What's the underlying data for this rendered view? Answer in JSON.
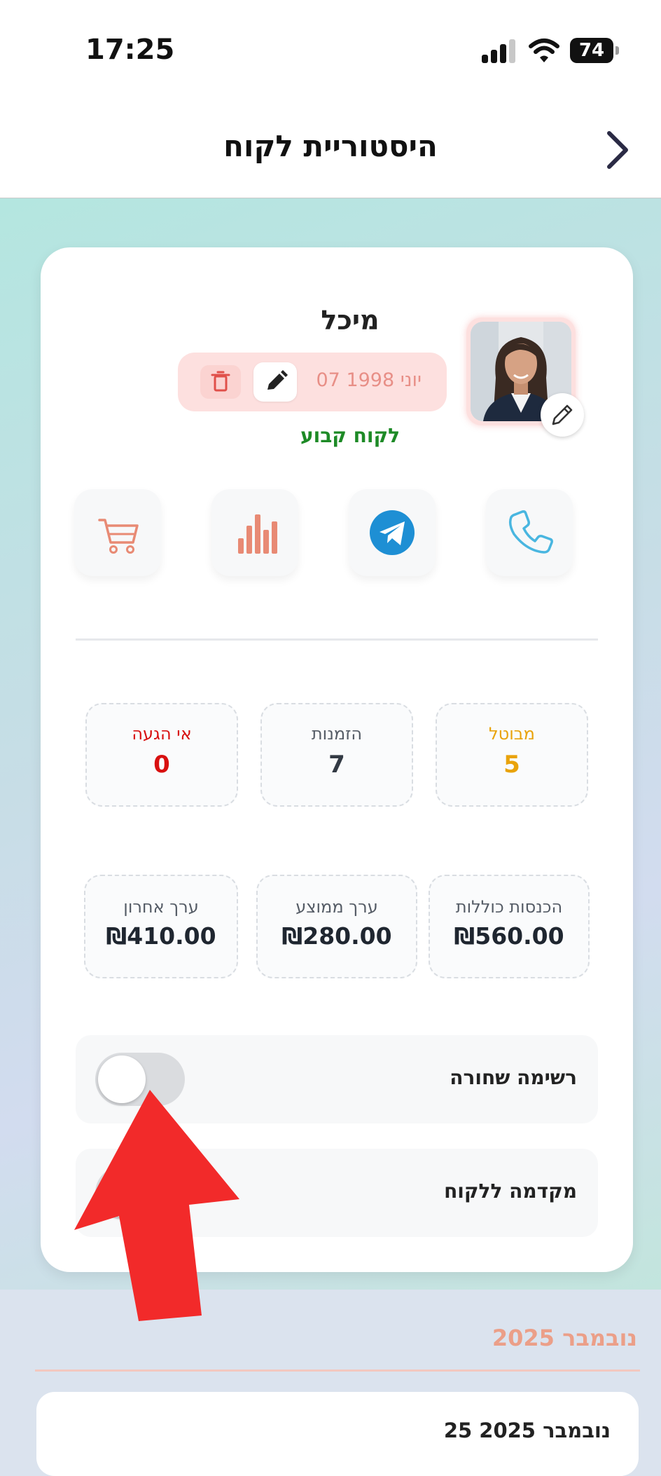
{
  "status_bar": {
    "time": "17:25",
    "battery_level": "74",
    "signal_bars": 3
  },
  "header": {
    "title": "היסטוריית לקוח"
  },
  "customer": {
    "name": "מיכל",
    "birthdate": "07 יוני 1998",
    "type": "לקוח קבוע",
    "avatar_icon": "customer-photo"
  },
  "actions": {
    "phone_icon": "phone-icon",
    "telegram_icon": "telegram-icon",
    "stats_icon": "bar-chart-icon",
    "cart_icon": "cart-icon"
  },
  "stats": [
    {
      "label": "מבוטל",
      "value": "5",
      "color": "#e9a30b"
    },
    {
      "label": "הזמנות",
      "value": "7",
      "color": "#333a44"
    },
    {
      "label": "אי הגעה",
      "value": "0",
      "color": "#d81010"
    }
  ],
  "money": [
    {
      "label": "הכנסות כוללות",
      "value": "₪560.00"
    },
    {
      "label": "ערך ממוצע",
      "value": "₪280.00"
    },
    {
      "label": "ערך אחרון",
      "value": "₪410.00"
    }
  ],
  "toggles": [
    {
      "label": "רשימה שחורה",
      "on": false
    },
    {
      "label": "מקדמה ללקוח",
      "on": false
    }
  ],
  "history": {
    "month": "נובמבר 2025",
    "orders": [
      {
        "date": "25 נובמבר 2025"
      }
    ]
  },
  "colors": {
    "accent": "#eb9f88",
    "regular_customer": "#1d8a26",
    "annotation_arrow": "#f22a2a"
  }
}
